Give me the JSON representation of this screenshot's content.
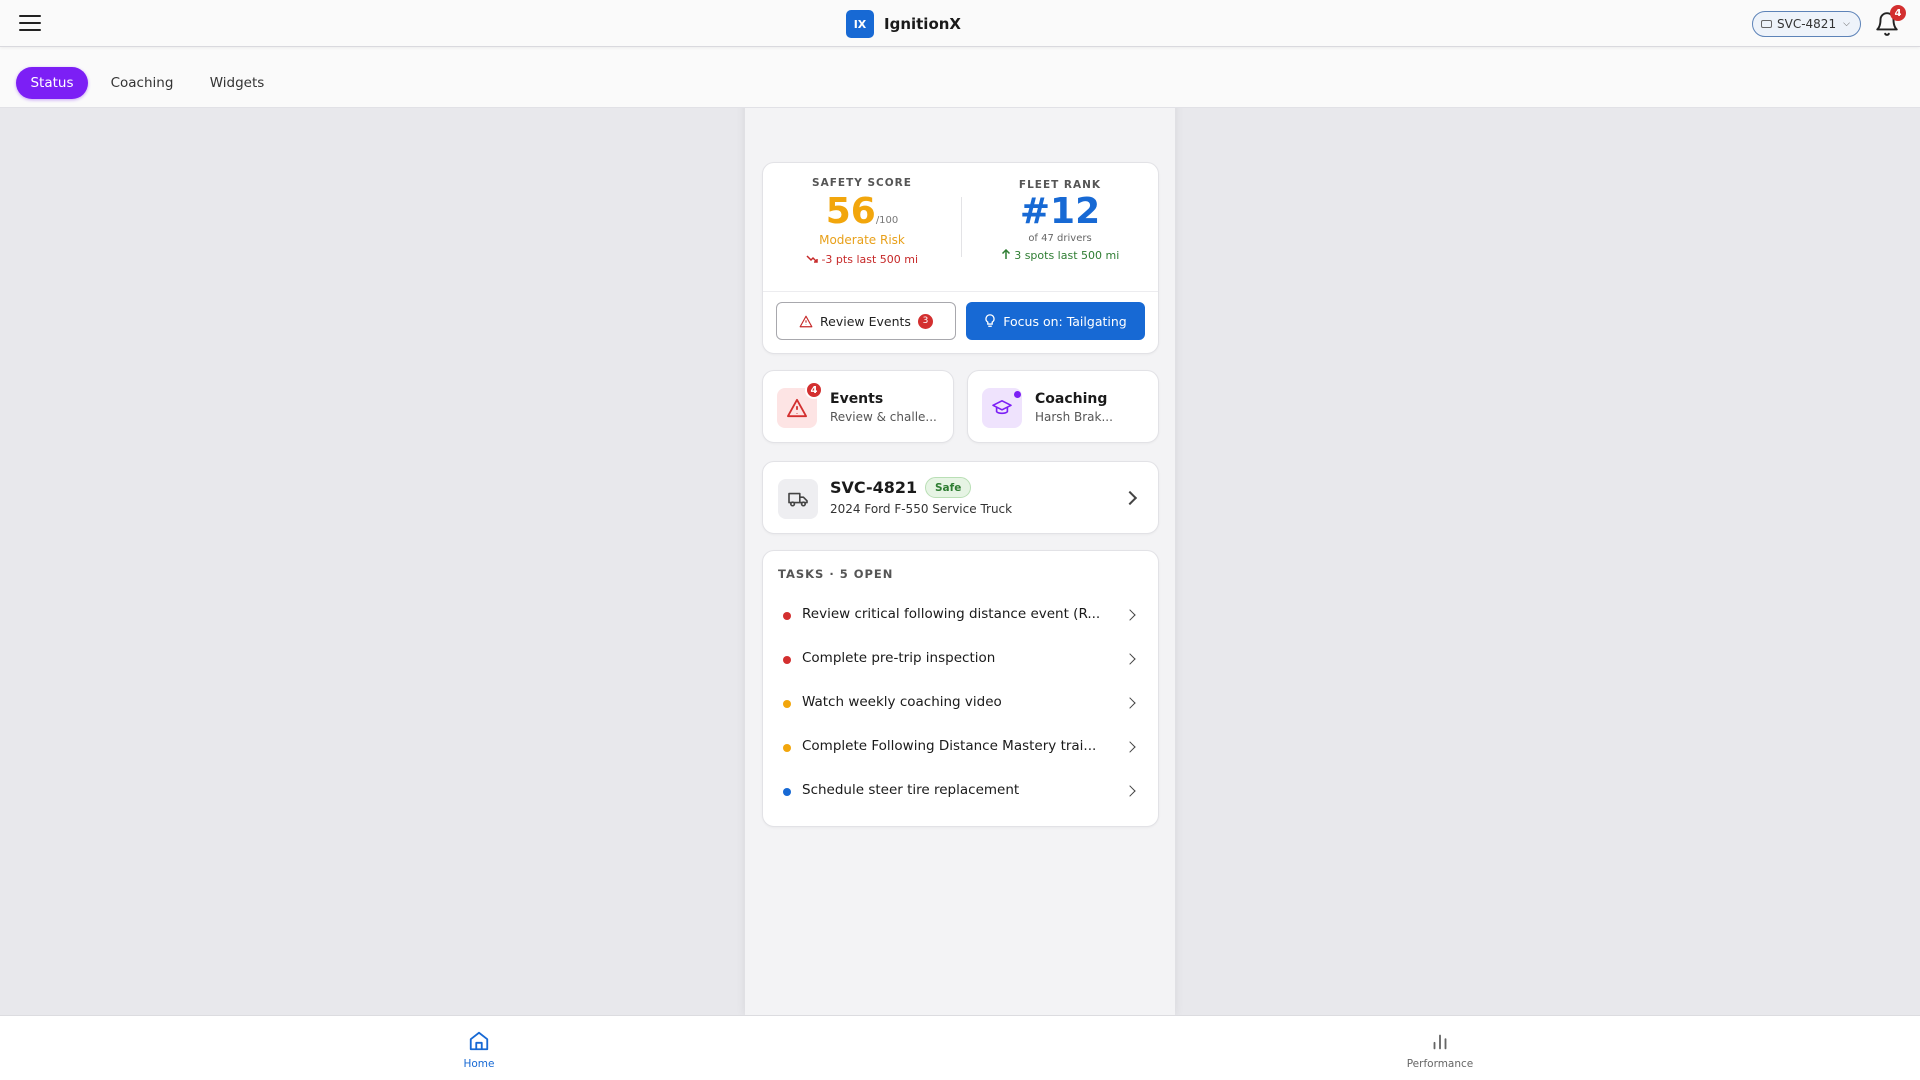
{
  "header": {
    "logo_text": "IX",
    "app_name": "IgnitionX",
    "vehicle_selector": "SVC-4821",
    "notification_count": "4"
  },
  "tabs": [
    {
      "label": "Status",
      "active": true
    },
    {
      "label": "Coaching",
      "active": false
    },
    {
      "label": "Widgets",
      "active": false
    }
  ],
  "score": {
    "safety_label": "SAFETY SCORE",
    "safety_value": "56",
    "safety_max": "/100",
    "risk_label": "Moderate Risk",
    "safety_trend": "-3 pts last 500 mi",
    "rank_label": "FLEET RANK",
    "rank_value": "#12",
    "rank_sub": "of 47 drivers",
    "rank_trend": "3 spots last 500 mi",
    "review_button": "Review Events",
    "review_count": "3",
    "focus_button": "Focus on: Tailgating"
  },
  "quick_cards": {
    "events": {
      "title": "Events",
      "subtitle": "Review & challe...",
      "badge": "4"
    },
    "coaching": {
      "title": "Coaching",
      "subtitle": "Harsh Brak..."
    }
  },
  "vehicle": {
    "id": "SVC-4821",
    "status": "Safe",
    "description": "2024 Ford F-550 Service Truck"
  },
  "tasks": {
    "title": "TASKS · 5 OPEN",
    "items": [
      {
        "text": "Review critical following distance event (R...",
        "priority_color": "#d32f2f"
      },
      {
        "text": "Complete pre-trip inspection",
        "priority_color": "#d32f2f"
      },
      {
        "text": "Watch weekly coaching video",
        "priority_color": "#f2a60c"
      },
      {
        "text": "Complete Following Distance Mastery trai...",
        "priority_color": "#f2a60c"
      },
      {
        "text": "Schedule steer tire replacement",
        "priority_color": "#1769d4"
      }
    ]
  },
  "bottom_nav": [
    {
      "label": "Home",
      "active": true
    },
    {
      "label": "Performance",
      "active": false
    }
  ],
  "colors": {
    "accent_purple": "#7c1ff5",
    "brand_blue": "#1769d4",
    "warning_amber": "#f2a60c",
    "danger_red": "#d32f2f",
    "success_green": "#2e7d32"
  }
}
